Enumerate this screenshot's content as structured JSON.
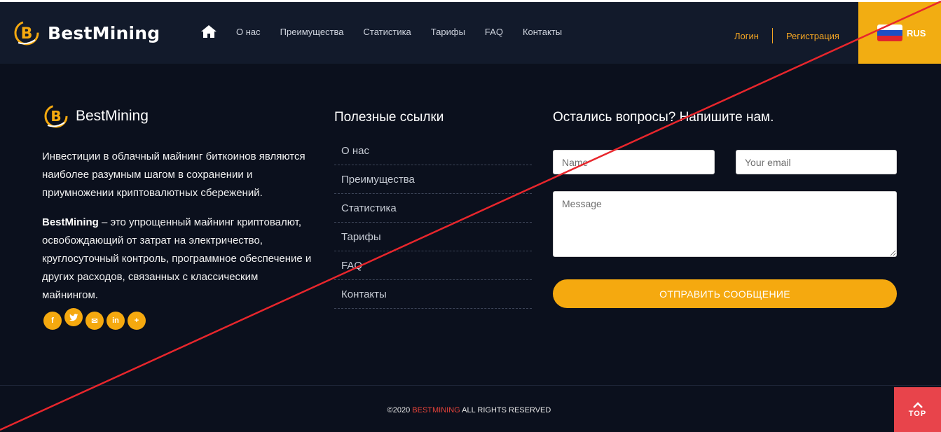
{
  "header": {
    "brand": "BestMining",
    "nav": [
      "О нас",
      "Преимущества",
      "Статистика",
      "Тарифы",
      "FAQ",
      "Контакты"
    ],
    "login": "Логин",
    "register": "Регистрация",
    "language": "RUS"
  },
  "footer": {
    "brand": "BestMining",
    "about1": "Инвестиции в облачный майнинг биткоинов являются наиболее разумным шагом в сохранении и приумножении криптовалютных сбережений.",
    "about2_brand": "BestMining",
    "about2_text": " – это упрощенный майнинг криптовалют, освобождающий от затрат на электричество, круглосуточный контроль, программное обеспечение и других расходов, связанных с классическим майнингом.",
    "social": [
      "f",
      "t",
      "✉",
      "in",
      "+"
    ],
    "links_title": "Полезные ссылки",
    "links": [
      "О нас",
      "Преимущества",
      "Статистика",
      "Тарифы",
      "FAQ",
      "Контакты"
    ],
    "contact_title": "Остались вопросы? Напишите нам.",
    "name_placeholder": "Name",
    "email_placeholder": "Your email",
    "message_placeholder": "Message",
    "send_label": "ОТПРАВИТЬ СООБЩЕНИЕ"
  },
  "bottom": {
    "copyright_prefix": "©2020 ",
    "copyright_brand": "BESTMINING",
    "copyright_suffix": " ALL RIGHTS RESERVED",
    "top_label": "TOP"
  },
  "colors": {
    "accent": "#f5a90f",
    "background": "#0b101d",
    "header": "#121a2b",
    "top_button": "#e8444b",
    "strike_line": "#e8262c"
  },
  "icons": [
    "bitcoin-logo-icon",
    "home-icon",
    "russia-flag-icon",
    "facebook-icon",
    "twitter-icon",
    "email-icon",
    "linkedin-icon",
    "plus-icon",
    "chevron-up-icon"
  ]
}
